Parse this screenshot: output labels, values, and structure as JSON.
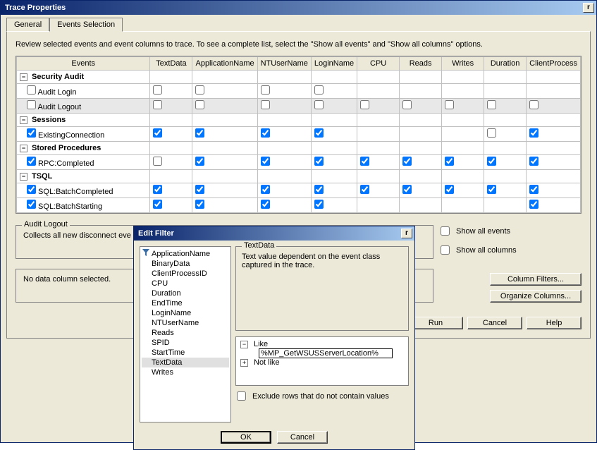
{
  "main_window": {
    "title": "Trace Properties",
    "tabs": {
      "general": "General",
      "events_selection": "Events Selection"
    },
    "instruction": "Review selected events and event columns to trace. To see a complete list, select the \"Show all events\" and \"Show all columns\" options.",
    "columns": [
      "Events",
      "TextData",
      "ApplicationName",
      "NTUserName",
      "LoginName",
      "CPU",
      "Reads",
      "Writes",
      "Duration",
      "ClientProcess"
    ],
    "categories": [
      {
        "name": "Security Audit",
        "events": [
          {
            "name": "Audit Login",
            "row_checked": false,
            "cells": [
              false,
              false,
              false,
              false,
              null,
              null,
              null,
              null,
              null
            ]
          },
          {
            "name": "Audit Logout",
            "row_checked": false,
            "cells": [
              false,
              false,
              false,
              false,
              false,
              false,
              false,
              false,
              false
            ],
            "selected": true
          }
        ]
      },
      {
        "name": "Sessions",
        "events": [
          {
            "name": "ExistingConnection",
            "row_checked": true,
            "cells": [
              true,
              true,
              true,
              true,
              null,
              null,
              null,
              false,
              true
            ]
          }
        ]
      },
      {
        "name": "Stored Procedures",
        "events": [
          {
            "name": "RPC:Completed",
            "row_checked": true,
            "cells": [
              false,
              true,
              true,
              true,
              true,
              true,
              true,
              true,
              true
            ]
          }
        ]
      },
      {
        "name": "TSQL",
        "events": [
          {
            "name": "SQL:BatchCompleted",
            "row_checked": true,
            "cells": [
              true,
              true,
              true,
              true,
              true,
              true,
              true,
              true,
              true
            ]
          },
          {
            "name": "SQL:BatchStarting",
            "row_checked": true,
            "cells": [
              true,
              true,
              true,
              true,
              null,
              null,
              null,
              null,
              true
            ]
          }
        ]
      }
    ],
    "detail": {
      "title": "Audit Logout",
      "text": "Collects all new disconnect eve"
    },
    "no_column": "No data column selected.",
    "show_all_events": "Show all events",
    "show_all_columns": "Show all columns",
    "column_filters_btn": "Column Filters...",
    "organize_columns_btn": "Organize Columns...",
    "run_btn": "Run",
    "cancel_btn": "Cancel",
    "help_btn": "Help"
  },
  "filter_dialog": {
    "title": "Edit Filter",
    "columns": [
      "ApplicationName",
      "BinaryData",
      "ClientProcessID",
      "CPU",
      "Duration",
      "EndTime",
      "LoginName",
      "NTUserName",
      "Reads",
      "SPID",
      "StartTime",
      "TextData",
      "Writes"
    ],
    "active_column": "ApplicationName",
    "selected_column": "TextData",
    "desc_title": "TextData",
    "desc_text": "Text value dependent on the event class captured in the trace.",
    "like_label": "Like",
    "notlike_label": "Not like",
    "like_value": "%MP_GetWSUSServerLocation%",
    "exclude_label": "Exclude rows that do not contain values",
    "ok_btn": "OK",
    "cancel_btn": "Cancel"
  }
}
